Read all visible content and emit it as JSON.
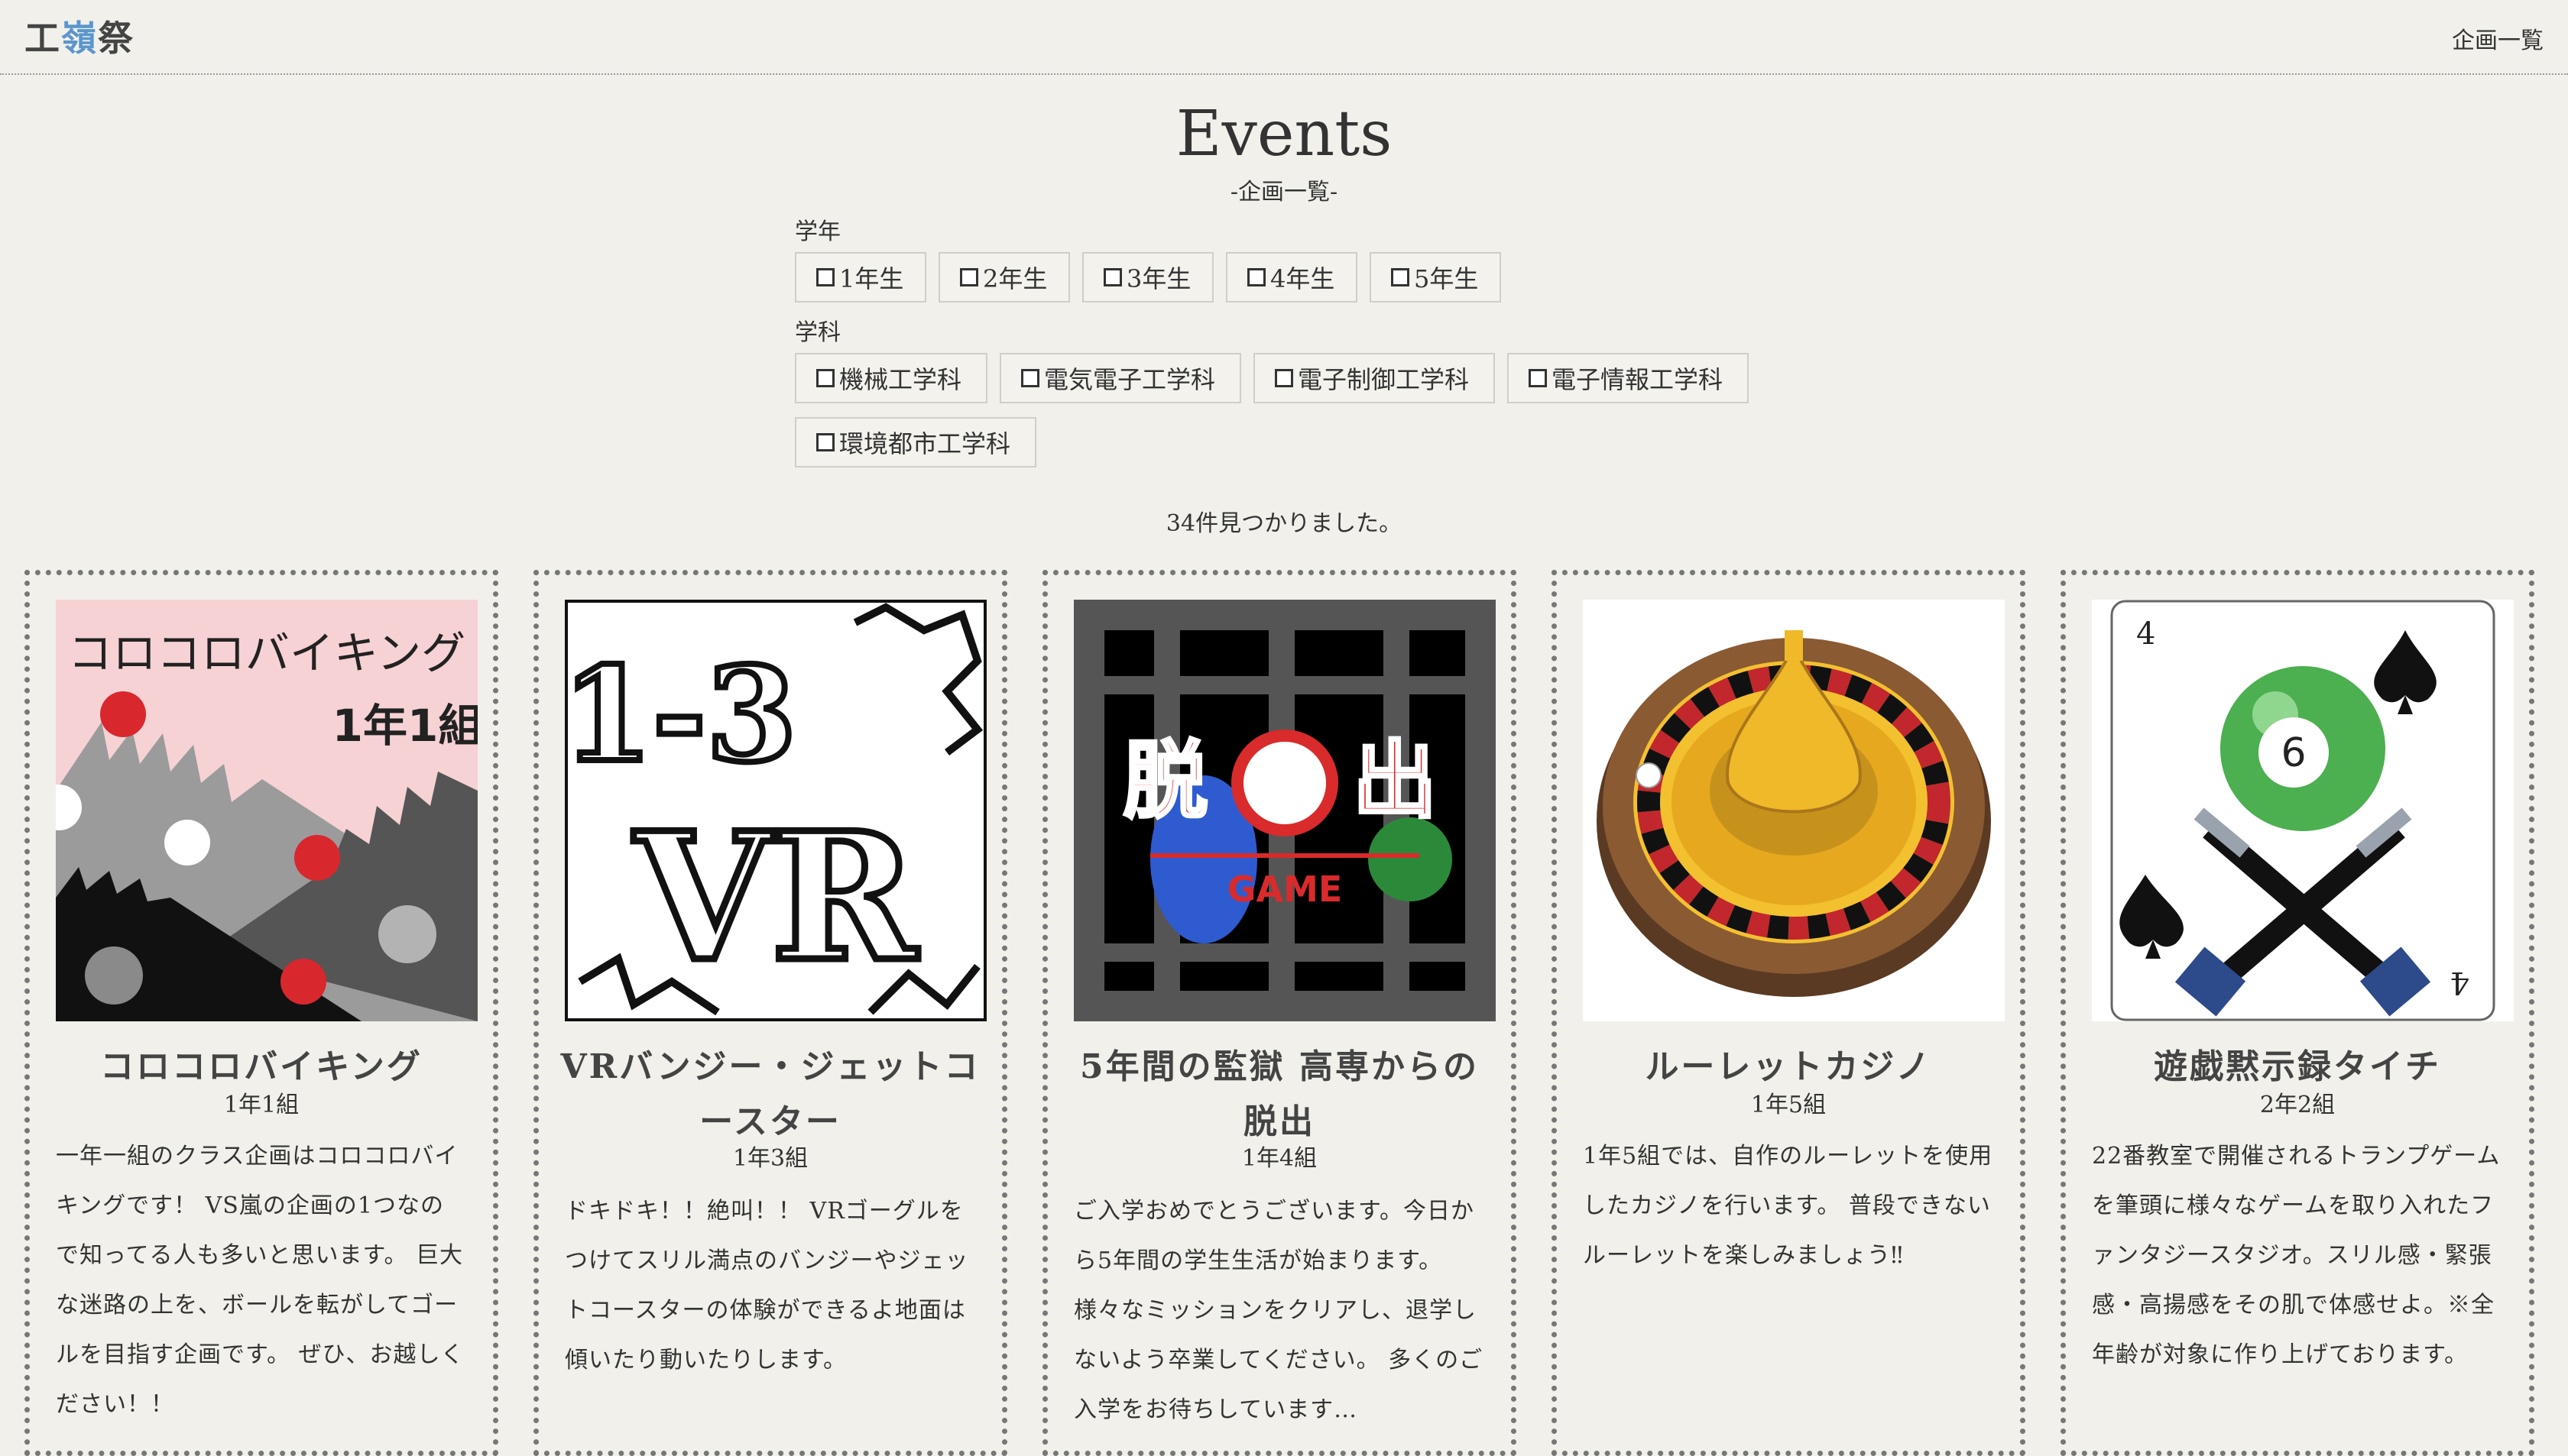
{
  "header": {
    "logo_a": "工",
    "logo_b": "嶺",
    "logo_c": "祭",
    "nav_link": "企画一覧"
  },
  "page": {
    "title": "Events",
    "subtitle": "-企画一覧-"
  },
  "filters": {
    "grade_label": "学年",
    "grades": [
      "1年生",
      "2年生",
      "3年生",
      "4年生",
      "5年生"
    ],
    "dept_label": "学科",
    "departments": [
      "機械工学科",
      "電気電子工学科",
      "電子制御工学科",
      "電子情報工学科",
      "環境都市工学科"
    ]
  },
  "result_count": "34件見つかりました。",
  "cards": [
    {
      "title": "コロコロバイキング",
      "class": "1年1組",
      "description": "一年一組のクラス企画はコロコロバイキングです！ VS嵐の企画の1つなので知ってる人も多いと思います。 巨大な迷路の上を、ボールを転がしてゴールを目指す企画です。 ぜひ、お越しください！！",
      "image_text": [
        "コロコロバイキング",
        "1年1組"
      ]
    },
    {
      "title": "VRバンジー・ジェットコースター",
      "class": "1年3組",
      "description": "ドキドキ！！絶叫！！ VRゴーグルをつけてスリル満点のバンジーやジェットコースターの体験ができるよ地面は傾いたり動いたりします。",
      "image_text": [
        "1-3",
        "VR"
      ]
    },
    {
      "title": "5年間の監獄 高専からの脱出",
      "class": "1年4組",
      "description": "ご入学おめでとうございます。今日から5年間の学生生活が始まります。 様々なミッションをクリアし、退学しないよう卒業してください。 多くのご入学をお待ちしています…",
      "image_text": [
        "脱",
        "出",
        "GAME"
      ]
    },
    {
      "title": "ルーレットカジノ",
      "class": "1年5組",
      "description": "1年5組では、自作のルーレットを使用したカジノを行います。 普段できないルーレットを楽しみましょう‼",
      "image_text": []
    },
    {
      "title": "遊戯黙示録タイチ",
      "class": "2年2組",
      "description": "22番教室で開催されるトランプゲームを筆頭に様々なゲームを取り入れたファンタジースタジオ。スリル感・緊張感・高揚感をその肌で体感せよ。※全年齢が対象に作り上げております。",
      "image_text": [
        "4",
        "6",
        "4"
      ]
    }
  ]
}
